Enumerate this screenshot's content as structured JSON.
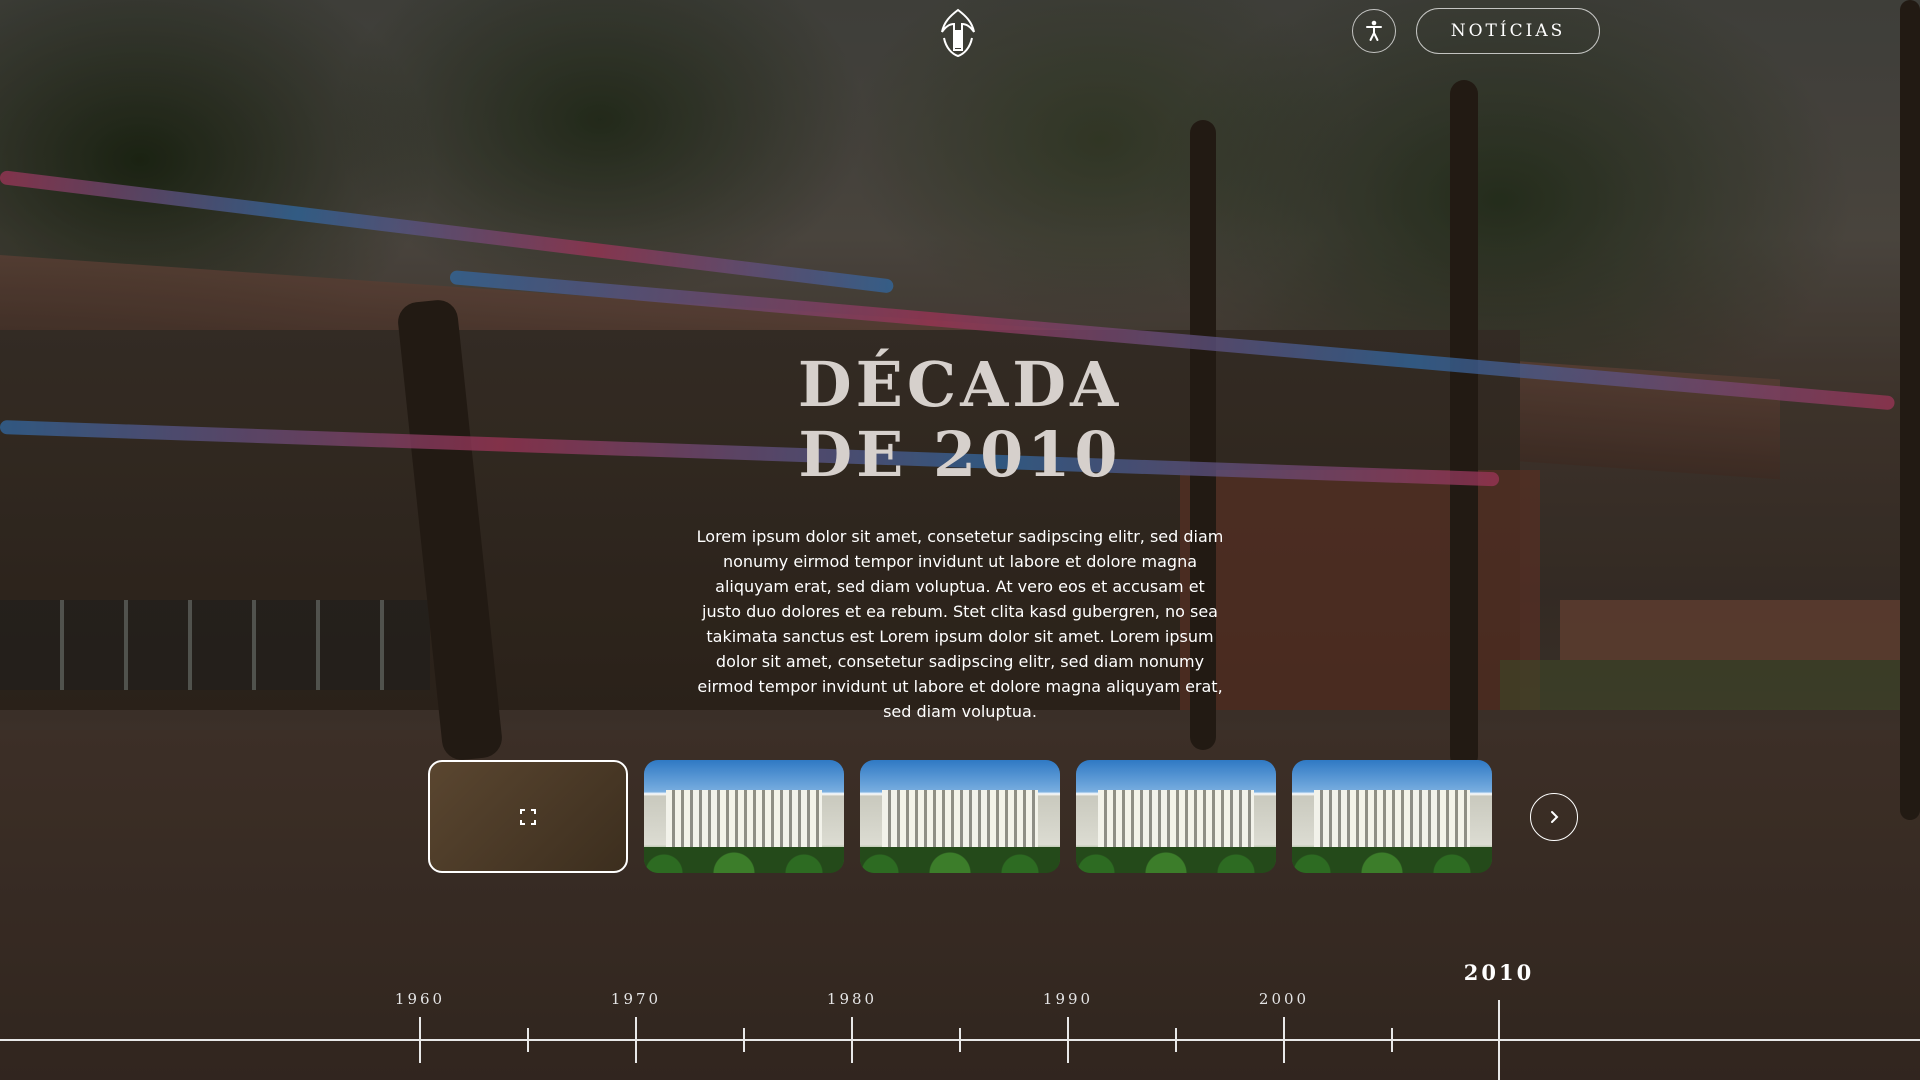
{
  "header": {
    "news_label": "NOTÍCIAS"
  },
  "hero": {
    "title_line1": "DÉCADA",
    "title_line2": "DE 2010",
    "description": "Lorem ipsum dolor sit amet, consetetur sadipscing elitr, sed diam nonumy eirmod tempor invidunt ut labore et dolore magna aliquyam erat, sed diam voluptua. At vero eos et accusam et justo duo dolores et ea rebum. Stet clita kasd gubergren, no sea takimata sanctus est Lorem ipsum dolor sit amet. Lorem ipsum dolor sit amet, consetetur sadipscing elitr, sed diam nonumy eirmod tempor invidunt ut labore et dolore magna aliquyam erat, sed diam voluptua."
  },
  "gallery": {
    "active_index": 0,
    "thumbnail_count": 5
  },
  "timeline": {
    "years": [
      "1960",
      "1970",
      "1980",
      "1990",
      "2000",
      "2010"
    ],
    "current": "2010"
  },
  "colors": {
    "text": "#ffffff",
    "title": "#d6d0cc",
    "line": "#e8e8e8"
  }
}
